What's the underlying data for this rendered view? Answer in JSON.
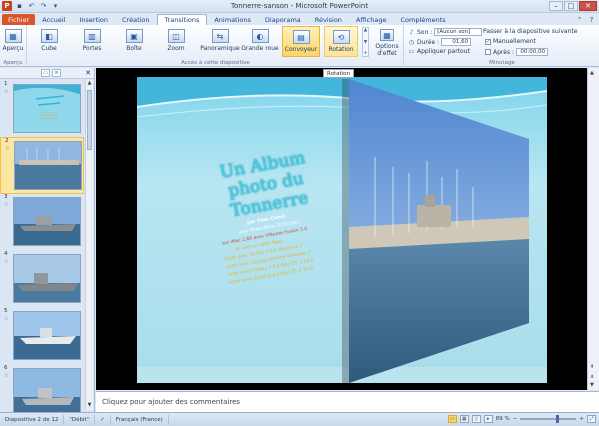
{
  "window": {
    "title": "Tonnerre-sanson  -  Microsoft PowerPoint",
    "app_icon_letter": "P"
  },
  "tabs": [
    {
      "label": "Fichier",
      "kind": "file"
    },
    {
      "label": "Accueil"
    },
    {
      "label": "Insertion"
    },
    {
      "label": "Création"
    },
    {
      "label": "Transitions",
      "active": true
    },
    {
      "label": "Animations"
    },
    {
      "label": "Diaporama"
    },
    {
      "label": "Révision"
    },
    {
      "label": "Affichage"
    },
    {
      "label": "Compléments"
    }
  ],
  "ribbon": {
    "preview": {
      "label": "Aperçu",
      "caption": "Aperçu"
    },
    "transitions": {
      "caption": "Accès à cette diapositive",
      "items": [
        {
          "label": "Cube"
        },
        {
          "label": "Portes"
        },
        {
          "label": "Boîte"
        },
        {
          "label": "Zoom"
        },
        {
          "label": "Panoramique"
        },
        {
          "label": "Grande roue"
        },
        {
          "label": "Convoyeur"
        },
        {
          "label": "Rotation"
        }
      ],
      "effect_options": "Options d'effet"
    },
    "timing": {
      "caption": "Minutage",
      "sound_label": "Son :",
      "sound_value": "[Aucun son]",
      "duration_label": "Durée :",
      "duration_value": "01,60",
      "apply_all": "Appliquer partout",
      "advance_title": "Passer à la diapositive suivante",
      "on_click_label": "Manuellement",
      "on_click_checked": true,
      "after_label": "Après :",
      "after_checked": false,
      "after_value": "00:00,00"
    }
  },
  "tooltip": "Rotation",
  "slide_panel": {
    "thumbnails": [
      {
        "number": "1",
        "selected": false
      },
      {
        "number": "2",
        "selected": true
      },
      {
        "number": "3",
        "selected": false
      },
      {
        "number": "4",
        "selected": false
      },
      {
        "number": "5",
        "selected": false
      },
      {
        "number": "6",
        "selected": false
      }
    ]
  },
  "slide": {
    "title": "Un Album photo du Tonnerre",
    "author": "par Yves Cornil",
    "lines": [
      "avec PowerPoint 2010 beta",
      "sur iMac 2,66 avec VMware Fusion 3.0",
      "et avec un Web Apps",
      "testé avec Firefox 3.5.6 Windows 7",
      "testé avec Google Chrome Windows 7",
      "testé avec Firefox 3.5.6 Mac OS X 10.6",
      "testé avec Safari 4.0.4 Mac OS X 10.6"
    ]
  },
  "notes_placeholder": "Cliquez pour ajouter des commentaires",
  "status": {
    "slide_info": "Diapositive 2 de 12",
    "theme": "\"Débit\"",
    "language": "Français (France)",
    "zoom": "89 %"
  },
  "colors": {
    "file_tab": "#d9552b",
    "selected_transition": "#fbd46a",
    "slide_title": "#3ed1e6"
  }
}
